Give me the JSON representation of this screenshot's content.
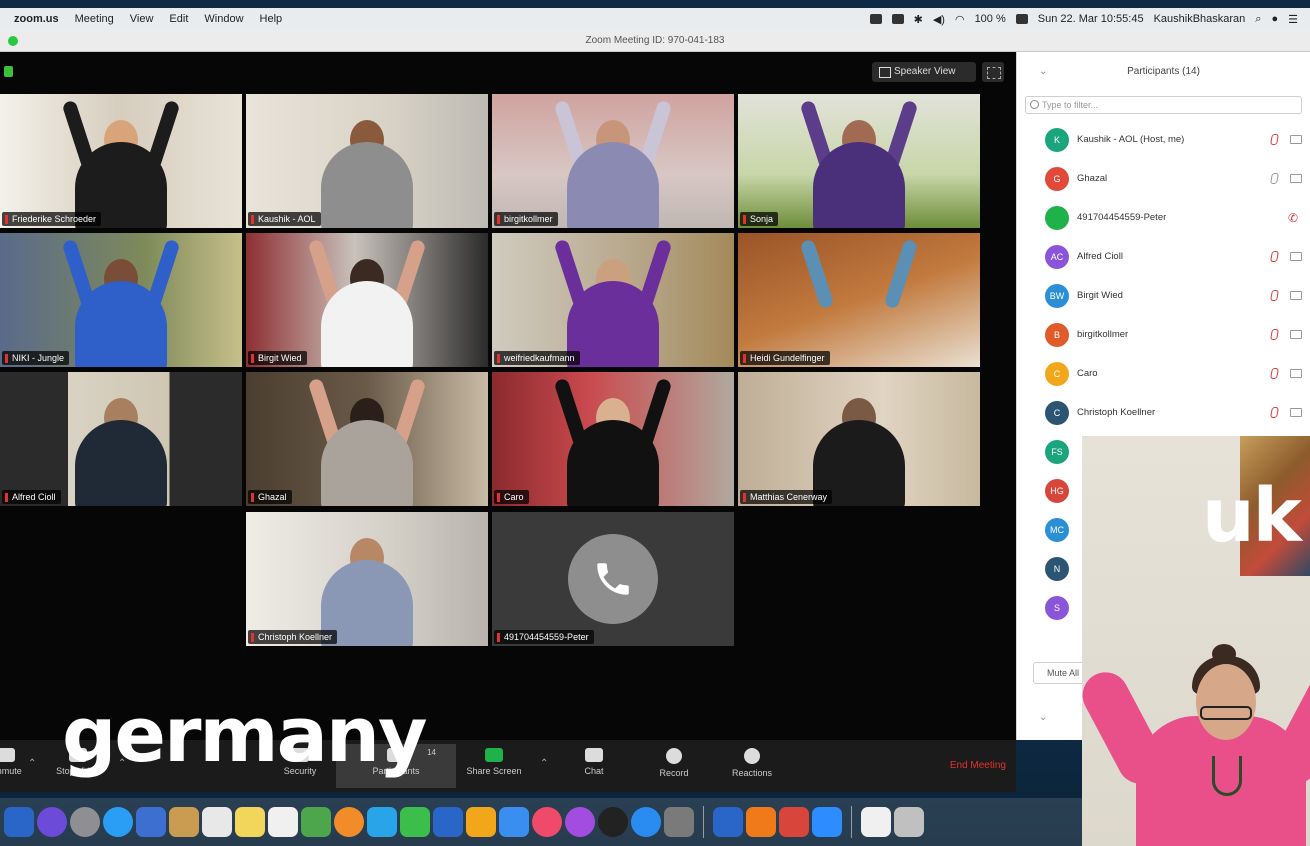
{
  "menubar": {
    "app": "zoom.us",
    "items": [
      "Meeting",
      "View",
      "Edit",
      "Window",
      "Help"
    ],
    "battery": "100 %",
    "clock": "Sun 22. Mar  10:55:45",
    "user": "KaushikBhaskaran"
  },
  "window": {
    "title": "Zoom Meeting ID: 970-041-183"
  },
  "view": {
    "speaker_view_label": "Speaker View"
  },
  "tiles": [
    {
      "name": "Friederike Schroeder"
    },
    {
      "name": "Kaushik - AOL"
    },
    {
      "name": "birgitkollmer"
    },
    {
      "name": "Sonja"
    },
    {
      "name": "NIKI - Jungle"
    },
    {
      "name": "Birgit Wied"
    },
    {
      "name": "weifriedkaufmann"
    },
    {
      "name": "Heidi Gundelfinger"
    },
    {
      "name": "Alfred Cioll"
    },
    {
      "name": "Ghazal"
    },
    {
      "name": "Caro"
    },
    {
      "name": "Matthias Cenerway"
    },
    {
      "name": "Christoph Koellner"
    },
    {
      "name": "491704454559-Peter"
    }
  ],
  "toolbar": {
    "items": [
      {
        "label": "Unmute"
      },
      {
        "label": "Stop Video"
      },
      {
        "label": "Security"
      },
      {
        "label": "Participants",
        "count": "14"
      },
      {
        "label": "Share Screen"
      },
      {
        "label": "Chat"
      },
      {
        "label": "Record"
      },
      {
        "label": "Reactions"
      }
    ],
    "end_label": "End Meeting"
  },
  "panel": {
    "title": "Participants (14)",
    "filter_placeholder": "Type to filter...",
    "mute_all": "Mute All",
    "participants": [
      {
        "initials": "K",
        "name": "Kaushik - AOL (Host, me)",
        "color": "#1aa57d"
      },
      {
        "initials": "G",
        "name": "Ghazal",
        "color": "#e1493a"
      },
      {
        "initials": "",
        "name": "491704454559-Peter",
        "color": "#1fb14a"
      },
      {
        "initials": "AC",
        "name": "Alfred Cioll",
        "color": "#8a55d8"
      },
      {
        "initials": "BW",
        "name": "Birgit Wied",
        "color": "#2b8fd6"
      },
      {
        "initials": "B",
        "name": "birgitkollmer",
        "color": "#e05a2a"
      },
      {
        "initials": "C",
        "name": "Caro",
        "color": "#f2a71b"
      },
      {
        "initials": "C",
        "name": "Christoph Koellner",
        "color": "#2c5573"
      },
      {
        "initials": "FS",
        "name": "",
        "color": "#1aa57d"
      },
      {
        "initials": "HG",
        "name": "",
        "color": "#d8453a"
      },
      {
        "initials": "MC",
        "name": "",
        "color": "#2b8fd6"
      },
      {
        "initials": "N",
        "name": "",
        "color": "#2c5573"
      },
      {
        "initials": "S",
        "name": "",
        "color": "#8a55d8"
      }
    ]
  },
  "overlay": {
    "left_country": "germany",
    "right_country": "uk"
  },
  "dock_colors": [
    "#2a66c8",
    "#6b4bd8",
    "#8e8e93",
    "#2a9df4",
    "#3d6fd1",
    "#c99c52",
    "#e8e8e8",
    "#f2d65c",
    "#f0f0f0",
    "#4da64b",
    "#f28c28",
    "#2aa4e8",
    "#3cbf4a",
    "#2a66c8",
    "#f2a71b",
    "#3a8ef0",
    "#f04a6a",
    "#a34de0",
    "#222",
    "#2a8cf0",
    "#7a7a7a",
    "#2a66c8",
    "#f07a1a",
    "#d8453a",
    "#2d8cff",
    "#f0f0f0",
    "#c0c0c0"
  ]
}
